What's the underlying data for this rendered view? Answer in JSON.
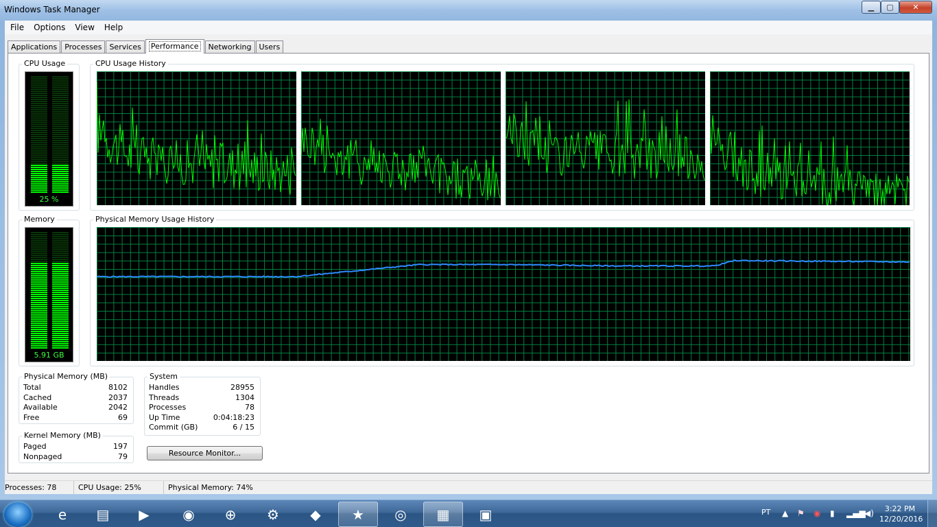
{
  "window": {
    "title": "Windows Task Manager"
  },
  "menu": [
    "File",
    "Options",
    "View",
    "Help"
  ],
  "tabs": [
    {
      "label": "Applications",
      "active": false
    },
    {
      "label": "Processes",
      "active": false
    },
    {
      "label": "Services",
      "active": false
    },
    {
      "label": "Performance",
      "active": true
    },
    {
      "label": "Networking",
      "active": false
    },
    {
      "label": "Users",
      "active": false
    }
  ],
  "cpu": {
    "title": "CPU Usage",
    "value_label": "25 %",
    "percent": 25,
    "history_title": "CPU Usage History"
  },
  "memory": {
    "title": "Memory",
    "value_label": "5.91 GB",
    "percent": 74,
    "history_title": "Physical Memory Usage History"
  },
  "physical_memory": {
    "title": "Physical Memory (MB)",
    "rows": [
      {
        "label": "Total",
        "value": "8102"
      },
      {
        "label": "Cached",
        "value": "2037"
      },
      {
        "label": "Available",
        "value": "2042"
      },
      {
        "label": "Free",
        "value": "69"
      }
    ]
  },
  "kernel_memory": {
    "title": "Kernel Memory (MB)",
    "rows": [
      {
        "label": "Paged",
        "value": "197"
      },
      {
        "label": "Nonpaged",
        "value": "79"
      }
    ]
  },
  "system": {
    "title": "System",
    "rows": [
      {
        "label": "Handles",
        "value": "28955"
      },
      {
        "label": "Threads",
        "value": "1304"
      },
      {
        "label": "Processes",
        "value": "78"
      },
      {
        "label": "Up Time",
        "value": "0:04:18:23"
      },
      {
        "label": "Commit (GB)",
        "value": "6 / 15"
      }
    ]
  },
  "buttons": {
    "resource_monitor": "Resource Monitor..."
  },
  "status": {
    "processes": "Processes: 78",
    "cpu": "CPU Usage: 25%",
    "memory": "Physical Memory: 74%"
  },
  "colors": {
    "graph_line": "#00ff00",
    "grid": "#008040",
    "memory_line": "#2e8bff",
    "gauge_on": "#00ff00",
    "gauge_off": "#0f5a0f"
  },
  "taskbar": {
    "items": [
      {
        "name": "internet-explorer-icon",
        "glyph": "e",
        "active": false
      },
      {
        "name": "file-explorer-icon",
        "glyph": "▤",
        "active": false
      },
      {
        "name": "media-player-icon",
        "glyph": "▶",
        "active": false
      },
      {
        "name": "chrome-icon",
        "glyph": "◉",
        "active": false
      },
      {
        "name": "globe-app-icon",
        "glyph": "⊕",
        "active": false
      },
      {
        "name": "steam-icon",
        "glyph": "⚙",
        "active": false
      },
      {
        "name": "game-wolf-icon",
        "glyph": "◆",
        "active": false
      },
      {
        "name": "game-grit-icon",
        "glyph": "★",
        "active": true
      },
      {
        "name": "network-app-icon",
        "glyph": "◎",
        "active": false
      },
      {
        "name": "task-manager-icon",
        "glyph": "▦",
        "active": true
      },
      {
        "name": "toolbox-icon",
        "glyph": "▣",
        "active": false
      }
    ],
    "lang": "PT",
    "time": "3:22 PM",
    "date": "12/20/2016"
  }
}
